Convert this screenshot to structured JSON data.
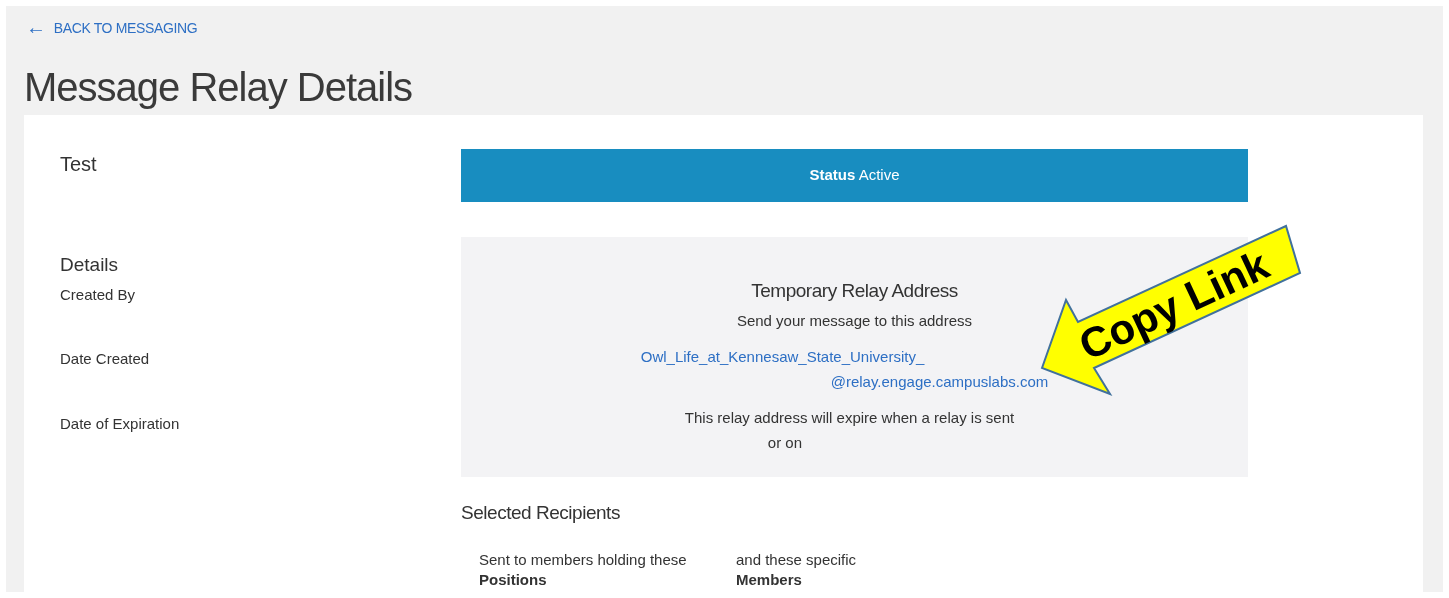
{
  "back_link": {
    "arrow": "←",
    "label": "BACK TO MESSAGING"
  },
  "page_title": "Message Relay Details",
  "relay_name": "Test",
  "details": {
    "heading": "Details",
    "fields": [
      "Created By",
      "Date Created",
      "Date of Expiration"
    ]
  },
  "status_bar": "**Status** Active",
  "relay_box": {
    "title": "Temporary Relay Address",
    "subtitle": "Send your message to this address",
    "address_line_1": "Owl_Life_at_Kennesaw_State_University_",
    "address_line_2": "@relay.engage.campuslabs.com",
    "expiry_line_1": "This relay address will expire when a relay is sent",
    "expiry_line_2": "or on"
  },
  "recipients": {
    "heading": "Selected Recipients",
    "columns": [
      {
        "intro": "Sent to members holding these",
        "label": "Positions"
      },
      {
        "intro": "and these specific",
        "label": "Members"
      }
    ]
  },
  "callout": {
    "label": "Copy Link"
  }
}
